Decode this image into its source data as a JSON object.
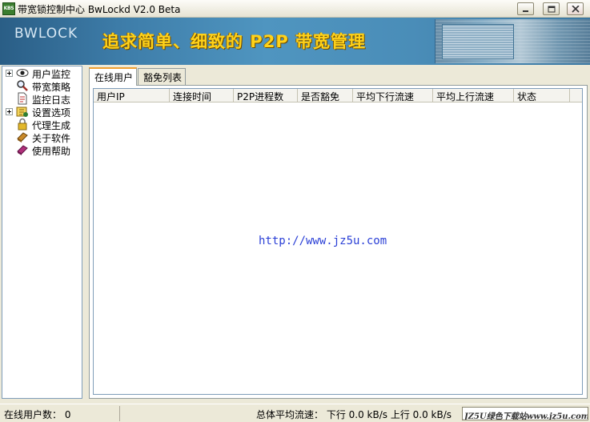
{
  "window": {
    "title": "带宽锁控制中心 BwLockd  V2.0 Beta",
    "icon_text": "KBS"
  },
  "banner": {
    "logo": "BWLOCK",
    "slogan": "追求简单、细致的 P2P 带宽管理"
  },
  "tree": {
    "items": [
      {
        "label": "用户监控",
        "icon": "eye-icon",
        "expandable": true
      },
      {
        "label": "带宽策略",
        "icon": "magnifier-icon",
        "expandable": false
      },
      {
        "label": "监控日志",
        "icon": "log-document-icon",
        "expandable": false
      },
      {
        "label": "设置选项",
        "icon": "settings-icon",
        "expandable": true
      },
      {
        "label": "代理生成",
        "icon": "lock-icon",
        "expandable": false
      },
      {
        "label": "关于软件",
        "icon": "book-icon",
        "expandable": false
      },
      {
        "label": "使用帮助",
        "icon": "help-book-icon",
        "expandable": false
      }
    ]
  },
  "tabs": [
    {
      "label": "在线用户",
      "active": true
    },
    {
      "label": "豁免列表",
      "active": false
    }
  ],
  "table": {
    "columns": [
      "用户IP",
      "连接时间",
      "P2P进程数",
      "是否豁免",
      "平均下行流速",
      "平均上行流速",
      "状态"
    ],
    "rows": []
  },
  "watermark": "http://www.jz5u.com",
  "status": {
    "online_users": "在线用户数： 0",
    "total_flow": "总体平均流速： 下行 0.0 kB/s  上行 0.0 kB/s",
    "brand": "JZ5U绿色下载站www.jz5u.com"
  },
  "colors": {
    "tab_accent": "#f0a030",
    "slogan": "#ffd21a",
    "watermark": "#2a3fd6"
  }
}
